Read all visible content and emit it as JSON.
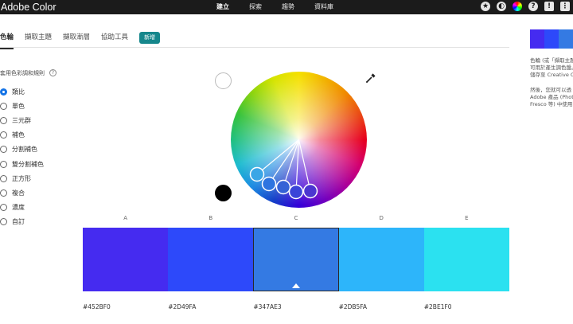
{
  "header": {
    "brand": "Adobe Color",
    "nav": [
      "建立",
      "探索",
      "趨勢",
      "資料庫"
    ],
    "icons": [
      "star-icon",
      "contrast-icon",
      "color-wheel-icon",
      "help-icon",
      "feedback-icon",
      "apps-grid-icon"
    ]
  },
  "tabs": [
    "色輪",
    "擷取主題",
    "擷取漸層",
    "協助工具"
  ],
  "badge": "新增",
  "rules": {
    "title": "套用色彩調和規則",
    "items": [
      "類比",
      "單色",
      "三元群",
      "補色",
      "分割補色",
      "雙分割補色",
      "正方形",
      "複合",
      "濃度",
      "自訂"
    ],
    "selected": 0
  },
  "palette": {
    "labels": [
      "A",
      "B",
      "C",
      "D",
      "E"
    ],
    "colors": [
      "#452BF0",
      "#2D49FA",
      "#347AE3",
      "#2DB5FA",
      "#2BE1F0"
    ],
    "hex_labels": [
      "#452BF0",
      "#2D49FA",
      "#347AE3",
      "#2DB5FA",
      "#2BE1F0"
    ],
    "selected": 2
  },
  "side": {
    "text1": [
      "色輪 (或「擷取主題」)",
      "可用於產生調色盤。",
      "儲存至 Creative Cl"
    ],
    "text2": [
      "然後，您就可以透",
      "Adobe 產品 (Photo",
      "Fresco 等) 中使用"
    ]
  }
}
